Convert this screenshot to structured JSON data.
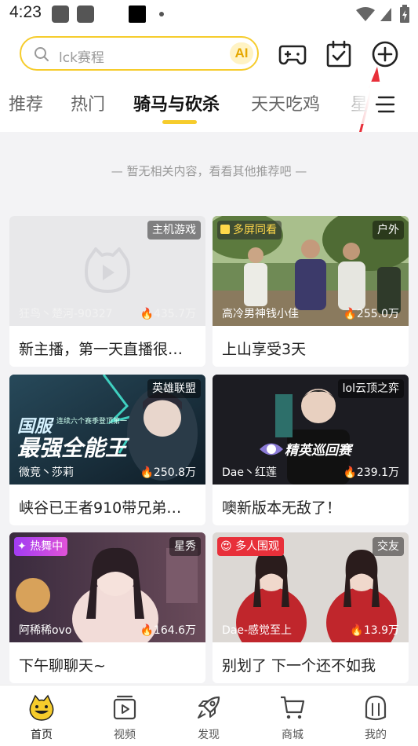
{
  "status_bar": {
    "time": "4:23"
  },
  "search": {
    "placeholder": "lck赛程",
    "ai_label": "AI"
  },
  "header_icons": [
    "gamepad-icon",
    "calendar-check-icon",
    "add-circle-icon"
  ],
  "tabs": [
    {
      "label": "推荐"
    },
    {
      "label": "热门"
    },
    {
      "label": "骑马与砍杀",
      "active": true
    },
    {
      "label": "天天吃鸡"
    },
    {
      "label": "星"
    }
  ],
  "empty_notice": "— 暂无相关内容，看看其他推荐吧 —",
  "cards": [
    {
      "category": "主机游戏",
      "anchor": "狂鸟丶楚河-90327",
      "viewers": "435.7万",
      "title": "新主播，第一天直播很…"
    },
    {
      "promo": "多屏同看",
      "category": "户外",
      "anchor": "高冷男神钱小佳",
      "viewers": "255.0万",
      "title": "上山享受3天"
    },
    {
      "category": "英雄联盟",
      "anchor": "微竞丶莎莉",
      "viewers": "250.8万",
      "title": "峡谷已王者910带兄弟…",
      "poster_line1": "国服",
      "poster_line2": "最强全能王",
      "poster_small": "连续六个赛季登顶第一"
    },
    {
      "category": "lol云顶之弈",
      "anchor": "Dae丶红莲",
      "viewers": "239.1万",
      "title": "噢新版本无敌了！",
      "poster_line1": "精英巡回赛"
    },
    {
      "promo": "热舞中",
      "category": "星秀",
      "anchor": "阿稀稀ovo",
      "viewers": "164.6万",
      "title": "下午聊聊天~"
    },
    {
      "promo": "多人围观",
      "category": "交友",
      "anchor": "Dae-感觉至上",
      "viewers": "13.9万",
      "title": "别划了 下一个还不如我"
    }
  ],
  "bottom_nav": [
    {
      "label": "首页",
      "icon": "home-mascot-icon",
      "active": true
    },
    {
      "label": "视频",
      "icon": "video-icon"
    },
    {
      "label": "发现",
      "icon": "rocket-icon"
    },
    {
      "label": "商城",
      "icon": "cart-icon"
    },
    {
      "label": "我的",
      "icon": "profile-icon"
    }
  ],
  "colors": {
    "accent": "#f6cc2c",
    "arrow": "#e8303a"
  }
}
